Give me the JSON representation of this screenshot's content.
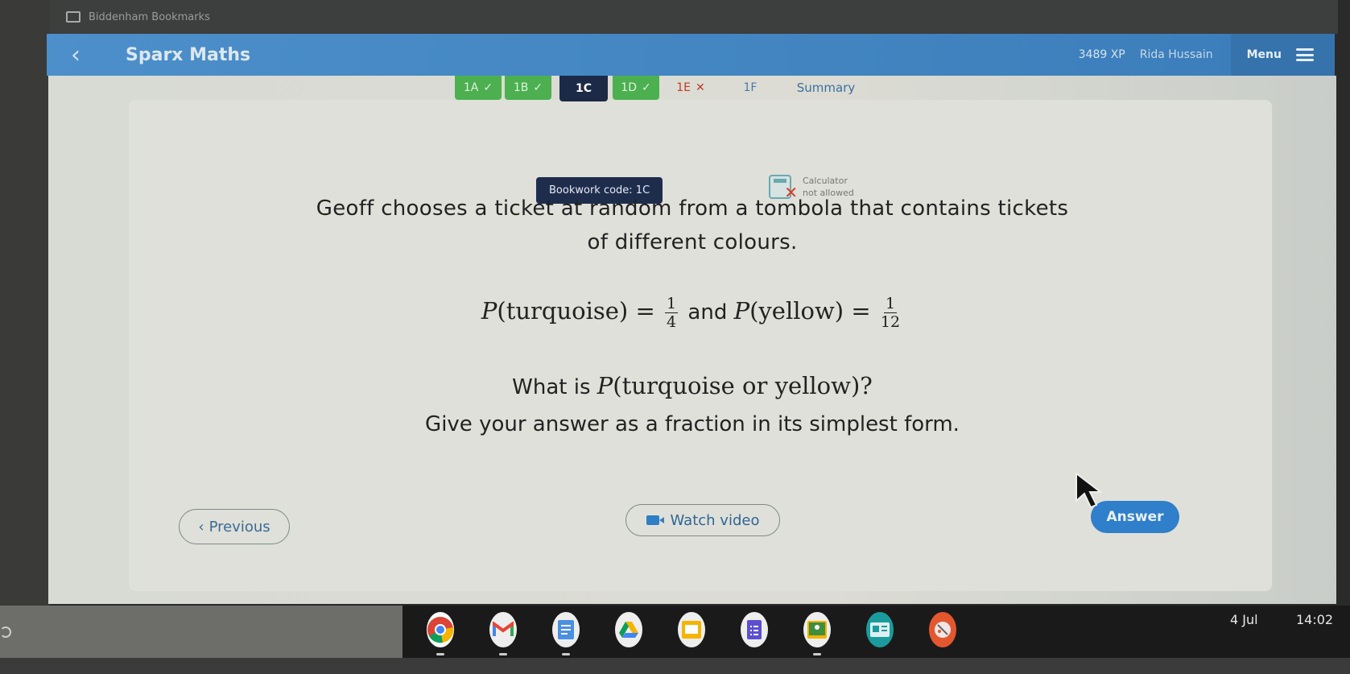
{
  "browser": {
    "bookmarks_folder": "Biddenham Bookmarks"
  },
  "header": {
    "title": "Sparx Maths",
    "xp": "3489 XP",
    "user_name": "Rida Hussain",
    "menu_label": "Menu"
  },
  "tabs": [
    {
      "label": "1A",
      "status": "done",
      "mark": "✓"
    },
    {
      "label": "1B",
      "status": "done",
      "mark": "✓"
    },
    {
      "label": "1C",
      "status": "current",
      "mark": ""
    },
    {
      "label": "1D",
      "status": "done",
      "mark": "✓"
    },
    {
      "label": "1E",
      "status": "failed",
      "mark": "✕"
    },
    {
      "label": "1F",
      "status": "pending",
      "mark": ""
    },
    {
      "label": "Summary",
      "status": "summary",
      "mark": ""
    }
  ],
  "question": {
    "bookwork_code": "Bookwork code: 1C",
    "calculator_line1": "Calculator",
    "calculator_line2": "not allowed",
    "line1": "Geoff chooses a ticket at random from a tombola that contains tickets",
    "line2": "of different colours.",
    "p_turquoise_label": "P",
    "p_turquoise_arg": "(turquoise)",
    "p_turquoise_num": "1",
    "p_turquoise_den": "4",
    "and_word": "and",
    "p_yellow_label": "P",
    "p_yellow_arg": "(yellow)",
    "p_yellow_num": "1",
    "p_yellow_den": "12",
    "equals": "=",
    "ask_prefix": "What is",
    "ask_math_p": "P",
    "ask_math_arg": "(turquoise or yellow)?",
    "instruction": "Give your answer as a fraction in its simplest form."
  },
  "buttons": {
    "previous": "Previous",
    "watch_video": "Watch video",
    "answer": "Answer"
  },
  "shelf": {
    "apps": [
      {
        "name": "chrome",
        "color": "#4285f4",
        "running": true
      },
      {
        "name": "gmail",
        "color": "#ea4335",
        "running": true
      },
      {
        "name": "docs",
        "color": "#4a90e2",
        "running": true
      },
      {
        "name": "drive",
        "color": "#34a853",
        "running": false
      },
      {
        "name": "slides",
        "color": "#f4b400",
        "running": false
      },
      {
        "name": "forms",
        "color": "#5c4fcf",
        "running": false
      },
      {
        "name": "classroom",
        "color": "#3e8e3e",
        "running": true
      },
      {
        "name": "sites",
        "color": "#1a9c9c",
        "running": false
      },
      {
        "name": "canvas",
        "color": "#e4572e",
        "running": false
      }
    ],
    "date": "4 Jul",
    "time": "14:02"
  }
}
